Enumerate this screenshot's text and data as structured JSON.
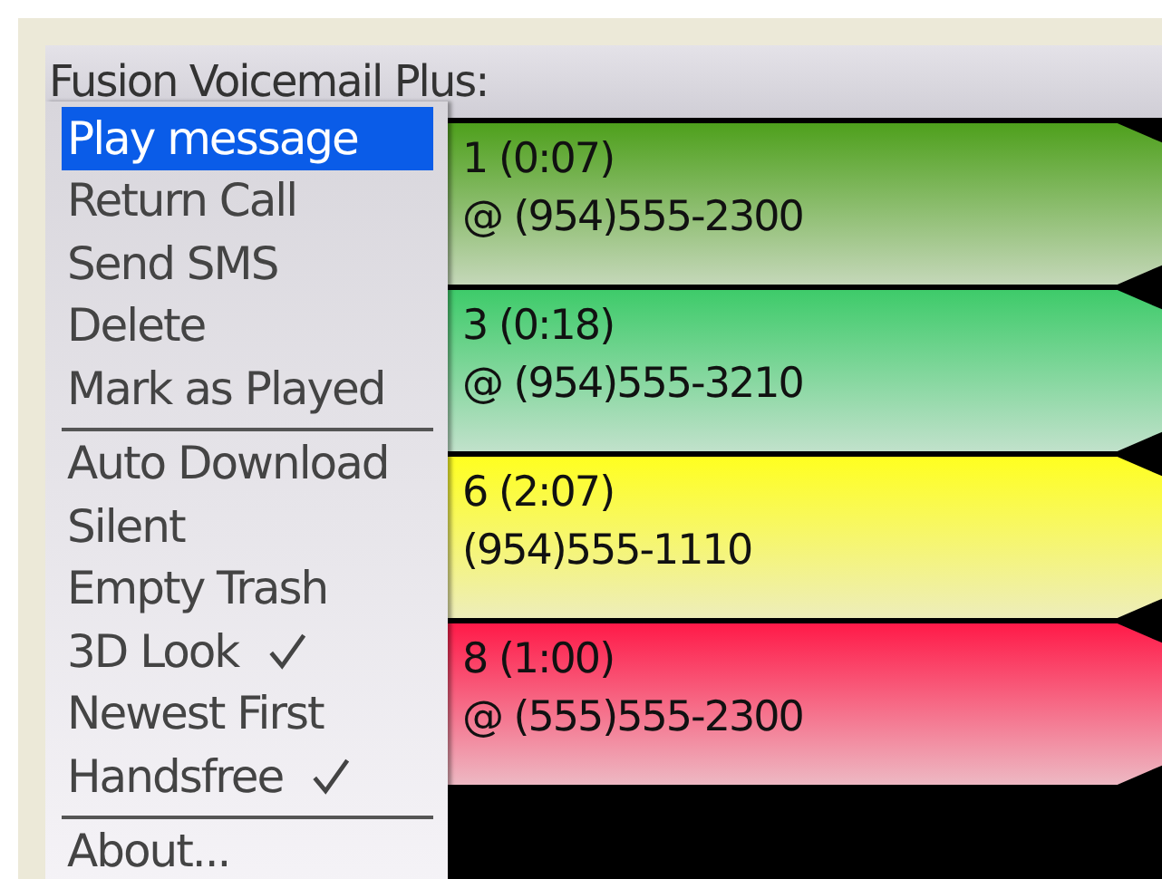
{
  "window": {
    "title": "Fusion Voicemail Plus:"
  },
  "messages": [
    {
      "line_1": "1  (0:07)",
      "line_2": "@ (954)555-2300",
      "color": "#4ea01c"
    },
    {
      "line_1": "3  (0:18)",
      "line_2": "@ (954)555-3210",
      "color": "#3ecb6a"
    },
    {
      "line_1": "6  (2:07)",
      "line_2": "(954)555-1110",
      "color": "#ffff20"
    },
    {
      "line_1": "8  (1:00)",
      "line_2": "@ (555)555-2300",
      "color": "#ff1a48"
    }
  ],
  "menu": {
    "groups": [
      [
        {
          "label": "Play message",
          "selected": true,
          "checked": false
        },
        {
          "label": "Return Call",
          "selected": false,
          "checked": false
        },
        {
          "label": "Send SMS",
          "selected": false,
          "checked": false
        },
        {
          "label": "Delete",
          "selected": false,
          "checked": false
        },
        {
          "label": "Mark as Played",
          "selected": false,
          "checked": false
        }
      ],
      [
        {
          "label": "Auto Download",
          "selected": false,
          "checked": false
        },
        {
          "label": "Silent",
          "selected": false,
          "checked": false
        },
        {
          "label": "Empty Trash",
          "selected": false,
          "checked": false
        },
        {
          "label": "3D Look",
          "selected": false,
          "checked": true
        },
        {
          "label": "Newest First",
          "selected": false,
          "checked": false
        },
        {
          "label": "Handsfree",
          "selected": false,
          "checked": true
        }
      ],
      [
        {
          "label": "About...",
          "selected": false,
          "checked": false
        }
      ]
    ]
  }
}
